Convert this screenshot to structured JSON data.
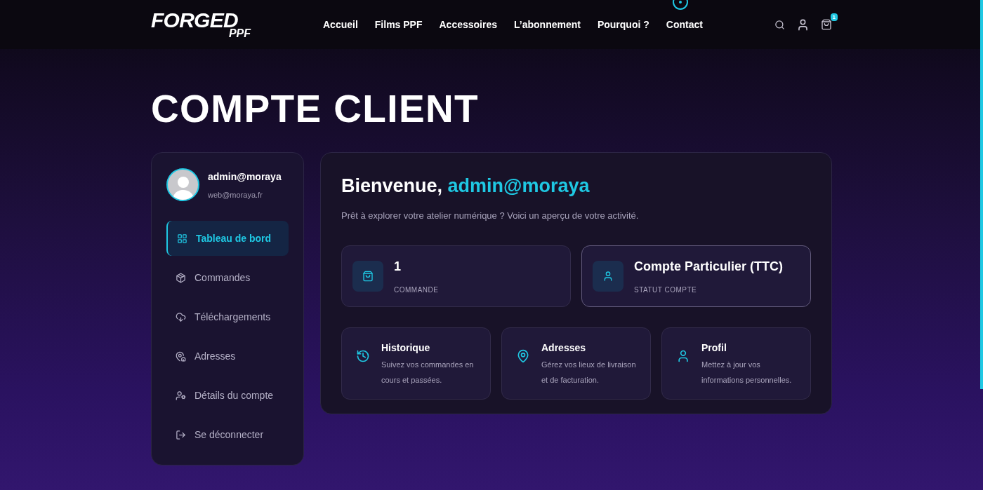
{
  "header": {
    "logo": {
      "word": "FORGED",
      "sub": "PPF"
    },
    "nav": [
      {
        "label": "Accueil"
      },
      {
        "label": "Films PPF"
      },
      {
        "label": "Accessoires"
      },
      {
        "label": "L’abonnement"
      },
      {
        "label": "Pourquoi ?"
      },
      {
        "label": "Contact"
      }
    ],
    "cart_count": "1"
  },
  "page_title": "COMPTE CLIENT",
  "sidebar": {
    "user": {
      "name": "admin@moraya",
      "email": "web@moraya.fr"
    },
    "items": [
      {
        "label": "Tableau de bord",
        "selected": true
      },
      {
        "label": "Commandes",
        "selected": false
      },
      {
        "label": "Téléchargements",
        "selected": false
      },
      {
        "label": "Adresses",
        "selected": false
      },
      {
        "label": "Détails du compte",
        "selected": false
      },
      {
        "label": "Se déconnecter",
        "selected": false
      }
    ]
  },
  "dashboard": {
    "greeting": "Bienvenue,",
    "username": "admin@moraya",
    "intro": "Prêt à explorer votre atelier numérique ? Voici un aperçu de votre activité.",
    "stats": [
      {
        "value": "1",
        "label": "COMMANDE",
        "selected": false
      },
      {
        "value": "Compte Particulier (TTC)",
        "label": "STATUT COMPTE",
        "selected": true
      }
    ],
    "shortcuts": [
      {
        "title": "Historique",
        "text": "Suivez vos commandes en cours et passées."
      },
      {
        "title": "Adresses",
        "text": "Gérez vos lieux de livraison et de facturation."
      },
      {
        "title": "Profil",
        "text": "Mettez à jour vos informations personnelles."
      }
    ]
  }
}
